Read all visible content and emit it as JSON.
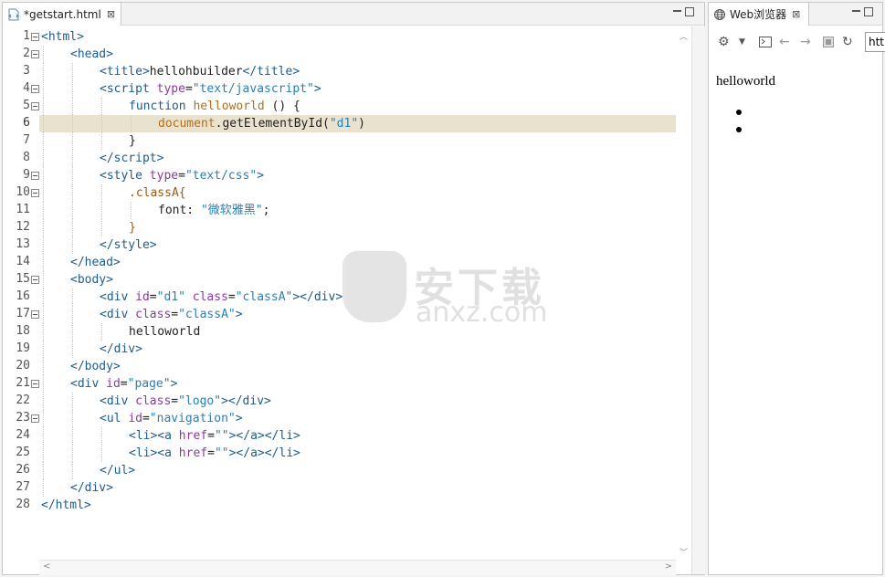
{
  "editor": {
    "tab_label": "*getstart.html",
    "tab_close": "⊠",
    "current_line": 6,
    "lines": [
      {
        "n": "1",
        "fold": true,
        "indent": 0,
        "html": "<span class='tag'>&lt;html&gt;</span>"
      },
      {
        "n": "2",
        "fold": true,
        "indent": 1,
        "html": "<span class='tag'>&lt;head&gt;</span>"
      },
      {
        "n": "3",
        "fold": false,
        "indent": 2,
        "html": "<span class='tag'>&lt;title&gt;</span><span class='plain'>hellohbuilder</span><span class='tag'>&lt;/title&gt;</span>"
      },
      {
        "n": "4",
        "fold": true,
        "indent": 2,
        "html": "<span class='tag'>&lt;script </span><span class='attr'>type</span><span class='plain'>=</span><span class='val'>\"text/javascript\"</span><span class='tag'>&gt;</span>"
      },
      {
        "n": "5",
        "fold": true,
        "indent": 3,
        "html": "<span class='kw'>function </span><span class='fn'>helloworld</span><span class='plain'> () {</span>"
      },
      {
        "n": "6",
        "fold": false,
        "indent": 4,
        "html": "<span class='fn'>document</span><span class='plain'>.getElementById(</span><span class='val'>\"d1\"</span><span class='plain'>)</span>"
      },
      {
        "n": "7",
        "fold": false,
        "indent": 3,
        "html": "<span class='plain'>}</span>"
      },
      {
        "n": "8",
        "fold": false,
        "indent": 2,
        "html": "<span class='tag'>&lt;/script&gt;</span>"
      },
      {
        "n": "9",
        "fold": true,
        "indent": 2,
        "html": "<span class='tag'>&lt;style </span><span class='attr'>type</span><span class='plain'>=</span><span class='val'>\"text/css\"</span><span class='tag'>&gt;</span>"
      },
      {
        "n": "10",
        "fold": true,
        "indent": 3,
        "html": "<span class='sel'>.classA{</span>"
      },
      {
        "n": "11",
        "fold": false,
        "indent": 4,
        "html": "<span class='plain'>font: </span><span class='val'>\"微软雅黑\"</span><span class='plain'>;</span>"
      },
      {
        "n": "12",
        "fold": false,
        "indent": 3,
        "html": "<span class='sel'>}</span>"
      },
      {
        "n": "13",
        "fold": false,
        "indent": 2,
        "html": "<span class='tag'>&lt;/style&gt;</span>"
      },
      {
        "n": "14",
        "fold": false,
        "indent": 1,
        "html": "<span class='tag'>&lt;/head&gt;</span>"
      },
      {
        "n": "15",
        "fold": true,
        "indent": 1,
        "html": "<span class='tag'>&lt;body&gt;</span>"
      },
      {
        "n": "16",
        "fold": false,
        "indent": 2,
        "html": "<span class='tag'>&lt;div </span><span class='attr'>id</span><span class='plain'>=</span><span class='val'>\"d1\"</span><span class='attr'> class</span><span class='plain'>=</span><span class='val'>\"classA\"</span><span class='tag'>&gt;&lt;/div&gt;</span>"
      },
      {
        "n": "17",
        "fold": true,
        "indent": 2,
        "html": "<span class='tag'>&lt;div </span><span class='attr'>class</span><span class='plain'>=</span><span class='val'>\"classA\"</span><span class='tag'>&gt;</span>"
      },
      {
        "n": "18",
        "fold": false,
        "indent": 3,
        "html": "<span class='plain'>helloworld</span>"
      },
      {
        "n": "19",
        "fold": false,
        "indent": 2,
        "html": "<span class='tag'>&lt;/div&gt;</span>"
      },
      {
        "n": "20",
        "fold": false,
        "indent": 1,
        "html": "<span class='tag'>&lt;/body&gt;</span>"
      },
      {
        "n": "21",
        "fold": true,
        "indent": 1,
        "html": "<span class='tag'>&lt;div </span><span class='attr'>id</span><span class='plain'>=</span><span class='val'>\"page\"</span><span class='tag'>&gt;</span>"
      },
      {
        "n": "22",
        "fold": false,
        "indent": 2,
        "html": "<span class='tag'>&lt;div </span><span class='attr'>class</span><span class='plain'>=</span><span class='val'>\"logo\"</span><span class='tag'>&gt;&lt;/div&gt;</span>"
      },
      {
        "n": "23",
        "fold": true,
        "indent": 2,
        "html": "<span class='tag'>&lt;ul </span><span class='attr'>id</span><span class='plain'>=</span><span class='val'>\"navigation\"</span><span class='tag'>&gt;</span>"
      },
      {
        "n": "24",
        "fold": false,
        "indent": 3,
        "html": "<span class='tag'>&lt;li&gt;&lt;a </span><span class='attr'>href</span><span class='plain'>=</span><span class='val'>\"\"</span><span class='tag'>&gt;&lt;/a&gt;&lt;/li&gt;</span>"
      },
      {
        "n": "25",
        "fold": false,
        "indent": 3,
        "html": "<span class='tag'>&lt;li&gt;&lt;a </span><span class='attr'>href</span><span class='plain'>=</span><span class='val'>\"\"</span><span class='tag'>&gt;&lt;/a&gt;&lt;/li&gt;</span>"
      },
      {
        "n": "26",
        "fold": false,
        "indent": 2,
        "html": "<span class='tag'>&lt;/ul&gt;</span>"
      },
      {
        "n": "27",
        "fold": false,
        "indent": 1,
        "html": "<span class='tag'>&lt;/div&gt;</span>"
      },
      {
        "n": "28",
        "fold": false,
        "indent": 0,
        "html": "<span class='tag'>&lt;/html&gt;</span>"
      }
    ]
  },
  "browser": {
    "tab_label": "Web浏览器",
    "tab_close": "⊠",
    "url_value": "htt",
    "toolbar_icons": [
      "gear-icon",
      "dropdown-icon",
      "console-icon",
      "back-icon",
      "forward-icon",
      "stop-icon",
      "refresh-icon"
    ],
    "content_text": "helloworld",
    "bullet_count": 2
  },
  "watermark": {
    "title": "安下载",
    "domain": "anxz.com"
  }
}
